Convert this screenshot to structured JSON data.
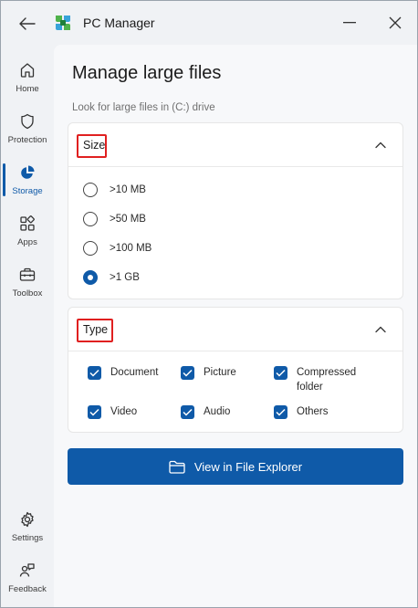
{
  "window": {
    "app_title": "PC Manager"
  },
  "sidebar": {
    "items": [
      {
        "label": "Home",
        "icon": "home-icon"
      },
      {
        "label": "Protection",
        "icon": "shield-icon"
      },
      {
        "label": "Storage",
        "icon": "pie-chart-icon",
        "active": true
      },
      {
        "label": "Apps",
        "icon": "apps-grid-icon"
      },
      {
        "label": "Toolbox",
        "icon": "toolbox-icon"
      },
      {
        "label": "Settings",
        "icon": "gear-icon"
      },
      {
        "label": "Feedback",
        "icon": "feedback-icon"
      }
    ]
  },
  "main": {
    "title": "Manage large files",
    "subtitle": "Look for large files in (C:) drive",
    "size_card": {
      "title": "Size",
      "options": [
        {
          "label": ">10 MB",
          "checked": false
        },
        {
          "label": ">50 MB",
          "checked": false
        },
        {
          "label": ">100 MB",
          "checked": false
        },
        {
          "label": ">1 GB",
          "checked": true
        }
      ]
    },
    "type_card": {
      "title": "Type",
      "options": [
        {
          "label": "Document",
          "checked": true
        },
        {
          "label": "Picture",
          "checked": true
        },
        {
          "label": "Compressed folder",
          "checked": true
        },
        {
          "label": "Video",
          "checked": true
        },
        {
          "label": "Audio",
          "checked": true
        },
        {
          "label": "Others",
          "checked": true
        }
      ]
    },
    "action_button": "View in File Explorer"
  },
  "colors": {
    "accent": "#0f5aa8",
    "highlight": "#e02020"
  }
}
